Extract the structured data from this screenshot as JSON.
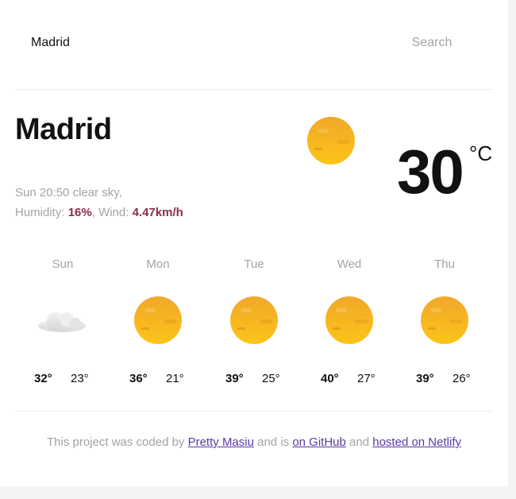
{
  "search": {
    "value": "Madrid",
    "button_label": "Search"
  },
  "current": {
    "city": "Madrid",
    "day_time": "Sun 20:50",
    "description": "clear sky,",
    "humidity_label": "Humidity:",
    "humidity_value": "16%",
    "wind_label": "Wind:",
    "wind_value": "4.47km/h",
    "temperature": "30",
    "unit": "°C",
    "icon": "sun-icon"
  },
  "forecast": [
    {
      "day": "Sun",
      "max": "32°",
      "min": "23°",
      "icon": "cloud-icon"
    },
    {
      "day": "Mon",
      "max": "36°",
      "min": "21°",
      "icon": "sun-icon"
    },
    {
      "day": "Tue",
      "max": "39°",
      "min": "25°",
      "icon": "sun-icon"
    },
    {
      "day": "Wed",
      "max": "40°",
      "min": "27°",
      "icon": "sun-icon"
    },
    {
      "day": "Thu",
      "max": "39°",
      "min": "26°",
      "icon": "sun-icon"
    }
  ],
  "footer": {
    "prefix": "This project was coded by",
    "author_link": "Pretty Masiu",
    "middle": "and is",
    "github_link": "on GitHub",
    "and": "and",
    "netlify_link": "hosted on Netlify"
  },
  "colors": {
    "highlight": "#8b2c4f",
    "link": "#5b3aa0",
    "muted": "#a3a3a8",
    "sun": "#f5b800"
  }
}
